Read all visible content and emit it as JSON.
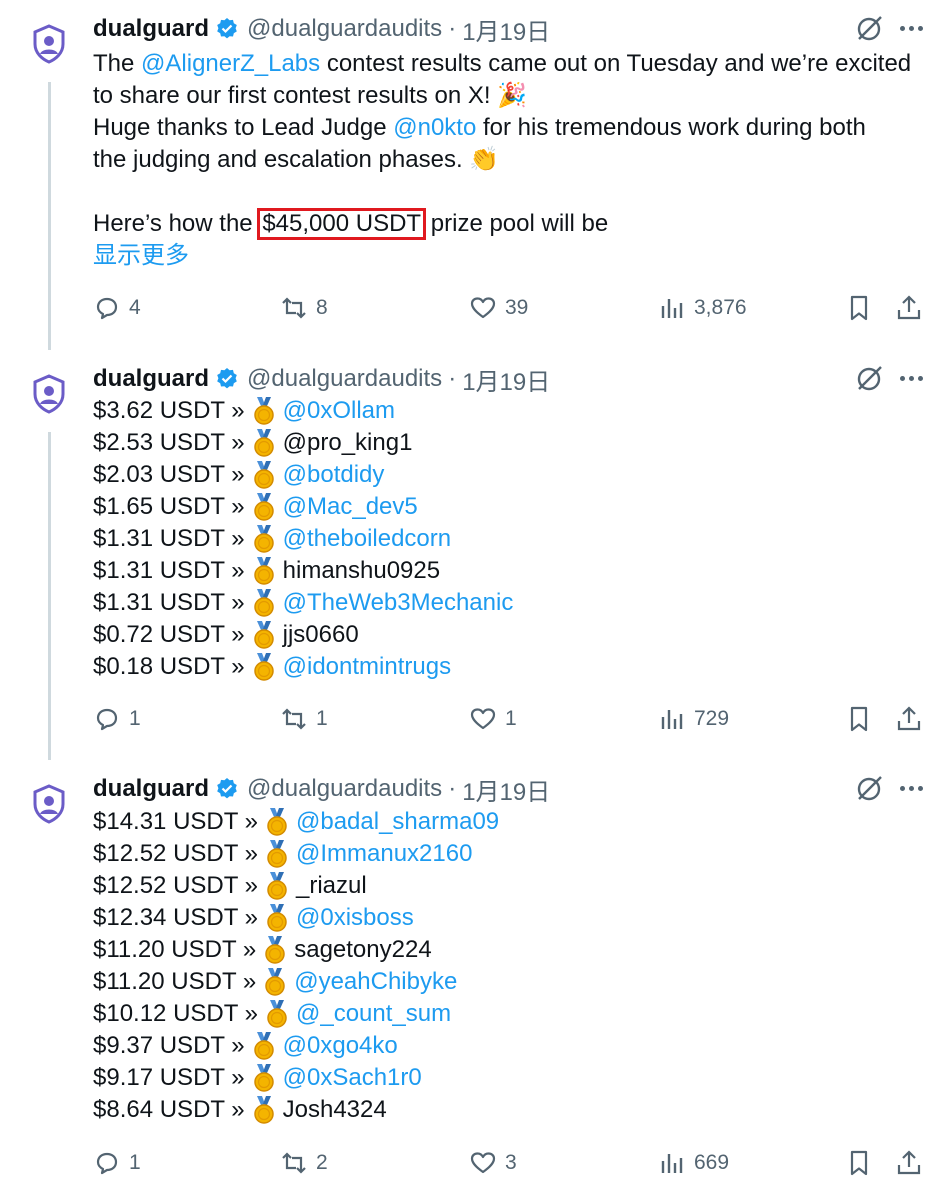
{
  "tweets": [
    {
      "author": {
        "name": "dualguard",
        "handle": "@dualguardaudits",
        "separator": "·",
        "date": "1月19日"
      },
      "body_lines": [
        [
          {
            "t": "text",
            "v": "The "
          },
          {
            "t": "mention",
            "v": "@AlignerZ_Labs"
          },
          {
            "t": "text",
            "v": " contest results came out on Tuesday and we’re excited"
          }
        ],
        [
          {
            "t": "text",
            "v": "to share our first contest results on X! 🎉"
          }
        ],
        [
          {
            "t": "text",
            "v": "Huge thanks to Lead Judge "
          },
          {
            "t": "mention",
            "v": "@n0kto"
          },
          {
            "t": "text",
            "v": " for his tremendous work during both"
          }
        ],
        [
          {
            "t": "text",
            "v": "the judging and escalation phases. 👏"
          }
        ],
        [
          {
            "t": "text",
            "v": ""
          }
        ],
        [
          {
            "t": "text",
            "v": "Here’s how the "
          },
          {
            "t": "highlight",
            "v": "$45,000 USDT"
          },
          {
            "t": "text",
            "v": " prize pool will be"
          }
        ]
      ],
      "show_more": "显示更多",
      "stats": {
        "replies": "4",
        "retweets": "8",
        "likes": "39",
        "views": "3,876"
      }
    },
    {
      "author": {
        "name": "dualguard",
        "handle": "@dualguardaudits",
        "separator": "·",
        "date": "1月19日"
      },
      "payouts": [
        {
          "amount": "$3.62 USDT »",
          "user": "@0xOllam",
          "mention": true
        },
        {
          "amount": "$2.53 USDT »",
          "user": "@pro_king1",
          "mention": false
        },
        {
          "amount": "$2.03 USDT »",
          "user": "@botdidy",
          "mention": true
        },
        {
          "amount": "$1.65 USDT »",
          "user": "@Mac_dev5",
          "mention": true
        },
        {
          "amount": "$1.31 USDT »",
          "user": "@theboiledcorn",
          "mention": true
        },
        {
          "amount": "$1.31 USDT »",
          "user": "himanshu0925",
          "mention": false
        },
        {
          "amount": "$1.31 USDT »",
          "user": "@TheWeb3Mechanic",
          "mention": true
        },
        {
          "amount": "$0.72 USDT »",
          "user": "jjs0660",
          "mention": false
        },
        {
          "amount": "$0.18 USDT »",
          "user": "@idontmintrugs",
          "mention": true
        }
      ],
      "stats": {
        "replies": "1",
        "retweets": "1",
        "likes": "1",
        "views": "729"
      }
    },
    {
      "author": {
        "name": "dualguard",
        "handle": "@dualguardaudits",
        "separator": "·",
        "date": "1月19日"
      },
      "payouts": [
        {
          "amount": "$14.31 USDT »",
          "user": "@badal_sharma09",
          "mention": true
        },
        {
          "amount": "$12.52 USDT »",
          "user": "@Immanux2160",
          "mention": true
        },
        {
          "amount": "$12.52 USDT »",
          "user": "_riazul",
          "mention": false
        },
        {
          "amount": "$12.34 USDT »",
          "user": "@0xisboss",
          "mention": true
        },
        {
          "amount": "$11.20 USDT »",
          "user": "sagetony224",
          "mention": false
        },
        {
          "amount": "$11.20 USDT »",
          "user": "@yeahChibyke",
          "mention": true
        },
        {
          "amount": "$10.12 USDT »",
          "user": "@_count_sum",
          "mention": true
        },
        {
          "amount": "$9.37 USDT »",
          "user": "@0xgo4ko",
          "mention": true
        },
        {
          "amount": "$9.17 USDT »",
          "user": "@0xSach1r0",
          "mention": true
        },
        {
          "amount": "$8.64 USDT »",
          "user": "Josh4324",
          "mention": false
        }
      ],
      "stats": {
        "replies": "1",
        "retweets": "2",
        "likes": "3",
        "views": "669"
      }
    }
  ],
  "colors": {
    "link": "#1d9bf0",
    "muted": "#536471",
    "text": "#0f1419",
    "highlight_box": "#e0191f",
    "verified": "#1d9bf0",
    "thread_line": "#cfd9de",
    "avatar": "#6b5cc7"
  },
  "icons": [
    "shield-avatar-icon",
    "verified-badge-icon",
    "grok-icon",
    "more-icon",
    "reply-icon",
    "retweet-icon",
    "like-icon",
    "views-icon",
    "bookmark-icon",
    "share-icon",
    "medal-icon"
  ]
}
